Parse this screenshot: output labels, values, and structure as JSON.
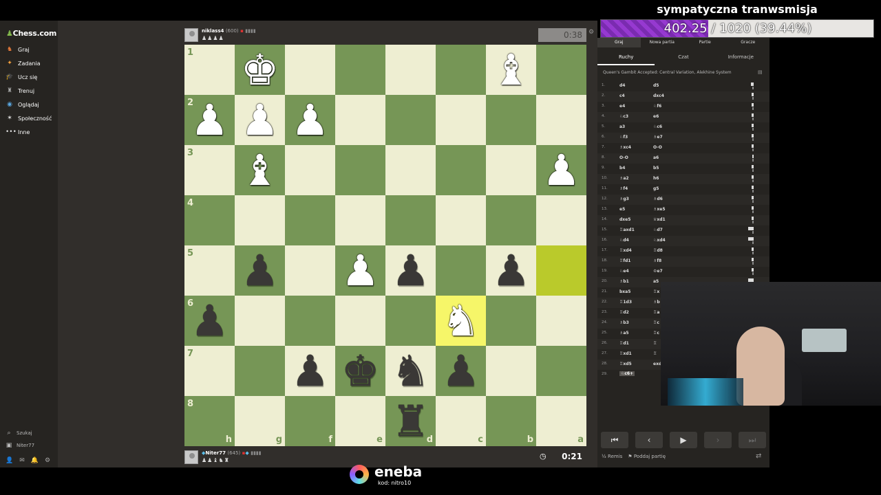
{
  "site": {
    "logo": "Chess.com"
  },
  "sidebar": {
    "items": [
      {
        "label": "Graj",
        "icon": "play-icon"
      },
      {
        "label": "Zadania",
        "icon": "puzzle-icon"
      },
      {
        "label": "Ucz się",
        "icon": "learn-icon"
      },
      {
        "label": "Trenuj",
        "icon": "train-icon"
      },
      {
        "label": "Oglądaj",
        "icon": "watch-icon"
      },
      {
        "label": "Społeczność",
        "icon": "community-icon"
      },
      {
        "label": "Inne",
        "icon": "more-icon"
      }
    ],
    "search_label": "Szukaj",
    "username": "Niter77"
  },
  "top_player": {
    "name": "niklass4",
    "rating": "(600)",
    "clock": "0:38",
    "captured": "♟♟♟♟"
  },
  "bottom_player": {
    "name": "Niter77",
    "rating": "(645)",
    "clock": "0:21",
    "captured": "♟♟♝♞♜"
  },
  "board": {
    "flipped": true,
    "ranks": [
      "1",
      "2",
      "3",
      "4",
      "5",
      "6",
      "7",
      "8"
    ],
    "files": [
      "h",
      "g",
      "f",
      "e",
      "d",
      "c",
      "b",
      "a"
    ],
    "highlight": [
      "a5",
      "c6"
    ],
    "pieces": {
      "g1": "wK",
      "b1": "wB",
      "h2": "wP",
      "g2": "wP",
      "f2": "wP",
      "g3": "wB",
      "a3": "wP",
      "g5": "bP",
      "e5": "wP",
      "d5": "bP",
      "b5": "bP",
      "h6": "bP",
      "c6": "wN",
      "f7": "bP",
      "e7": "bK",
      "d7": "bN",
      "c7": "bP",
      "d8": "bR"
    }
  },
  "panel": {
    "top_tabs": [
      "Graj",
      "Nowa partia",
      "Partie",
      "Gracze"
    ],
    "sub_tabs": [
      "Ruchy",
      "Czat",
      "Informacje"
    ],
    "opening": "Queen's Gambit Accepted: Central Variation, Alekhine System",
    "moves": [
      {
        "n": "1.",
        "w": "d4",
        "b": "d5"
      },
      {
        "n": "2.",
        "w": "c4",
        "b": "dxc4"
      },
      {
        "n": "3.",
        "w": "e4",
        "b": "♘f6"
      },
      {
        "n": "4.",
        "w": "♘c3",
        "b": "e6"
      },
      {
        "n": "5.",
        "w": "a3",
        "b": "♘c6"
      },
      {
        "n": "6.",
        "w": "♘f3",
        "b": "♗e7"
      },
      {
        "n": "7.",
        "w": "♗xc4",
        "b": "O-O"
      },
      {
        "n": "8.",
        "w": "O-O",
        "b": "a6"
      },
      {
        "n": "9.",
        "w": "b4",
        "b": "b5"
      },
      {
        "n": "10.",
        "w": "♗a2",
        "b": "h6"
      },
      {
        "n": "11.",
        "w": "♗f4",
        "b": "g5"
      },
      {
        "n": "12.",
        "w": "♗g3",
        "b": "♗d6"
      },
      {
        "n": "13.",
        "w": "e5",
        "b": "♗xe5"
      },
      {
        "n": "14.",
        "w": "dxe5",
        "b": "♕xd1"
      },
      {
        "n": "15.",
        "w": "♖axd1",
        "b": "♘d7"
      },
      {
        "n": "16.",
        "w": "♘d4",
        "b": "♘xd4"
      },
      {
        "n": "17.",
        "w": "♖xd4",
        "b": "♖d8"
      },
      {
        "n": "18.",
        "w": "♖fd1",
        "b": "♗f8"
      },
      {
        "n": "19.",
        "w": "♘e4",
        "b": "♔e7"
      },
      {
        "n": "20.",
        "w": "♗b1",
        "b": "a5"
      },
      {
        "n": "21.",
        "w": "bxa5",
        "b": "♖x"
      },
      {
        "n": "22.",
        "w": "♖1d3",
        "b": "♗b"
      },
      {
        "n": "23.",
        "w": "♖d2",
        "b": "♖a"
      },
      {
        "n": "24.",
        "w": "♗b3",
        "b": "♖c"
      },
      {
        "n": "25.",
        "w": "♗a5",
        "b": "♖c"
      },
      {
        "n": "26.",
        "w": "♖d1",
        "b": "♖"
      },
      {
        "n": "27.",
        "w": "♖xd1",
        "b": "♖"
      },
      {
        "n": "28.",
        "w": "♖xd5",
        "b": "exd"
      },
      {
        "n": "29.",
        "w": "♘c6+",
        "b": ""
      }
    ],
    "draw_label": "Remis",
    "resign_label": "Poddaj partię"
  },
  "overlay": {
    "title": "sympatyczna tranwsmisja",
    "goal_current": "402.25",
    "goal_total": " / 1020 (39.44%)",
    "goal_fraction": 0.3944
  },
  "sponsor": {
    "name": "eneba",
    "code": "kod: nitro10"
  }
}
